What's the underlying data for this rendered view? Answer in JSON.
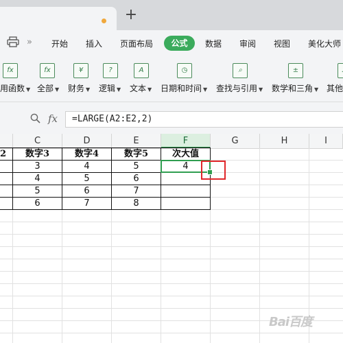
{
  "menu": {
    "items": [
      "开始",
      "插入",
      "页面布局",
      "数据",
      "审阅",
      "视图",
      "美化大师"
    ],
    "active": "公式",
    "more": "»"
  },
  "ribbon": {
    "groups": [
      {
        "label": "用函数",
        "icon_text": "fx"
      },
      {
        "label": "全部",
        "icon_text": "fx"
      },
      {
        "label": "财务",
        "icon_text": "¥"
      },
      {
        "label": "逻辑",
        "icon_text": "?"
      },
      {
        "label": "文本",
        "icon_text": "A"
      },
      {
        "label": "日期和时间",
        "icon_text": "◷"
      },
      {
        "label": "查找与引用",
        "icon_text": "⌕"
      },
      {
        "label": "数学和三角",
        "icon_text": "±"
      },
      {
        "label": "其他",
        "icon_text": "…"
      }
    ]
  },
  "formula_bar": {
    "fx": "fx",
    "formula": "=LARGE(A2:E2,2)"
  },
  "columns": [
    "C",
    "D",
    "E",
    "F",
    "G",
    "H",
    "I"
  ],
  "selected_column": "F",
  "table": {
    "partial_header": "2",
    "headers": [
      "数字3",
      "数字4",
      "数字5",
      "次大值"
    ],
    "rows": [
      [
        "3",
        "4",
        "5",
        "4"
      ],
      [
        "4",
        "5",
        "6",
        ""
      ],
      [
        "5",
        "6",
        "7",
        ""
      ],
      [
        "6",
        "7",
        "8",
        ""
      ]
    ]
  },
  "watermark": "Bai百度"
}
